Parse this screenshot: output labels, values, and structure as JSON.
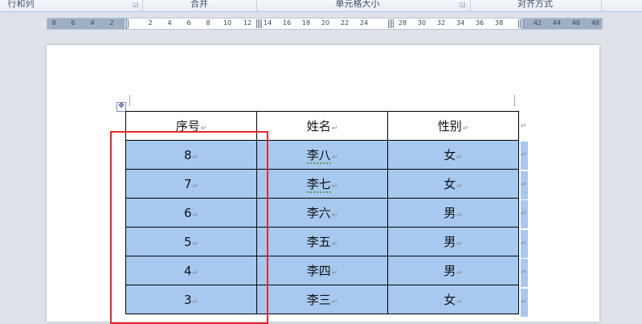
{
  "ribbon": {
    "groups": [
      {
        "label": "行和列"
      },
      {
        "label": "合并"
      },
      {
        "label": "单元格大小"
      },
      {
        "label": "对齐方式"
      }
    ]
  },
  "ruler": {
    "ticks": [
      "8",
      "6",
      "4",
      "2",
      "2",
      "4",
      "6",
      "8",
      "10",
      "12",
      "14",
      "16",
      "18",
      "20",
      "22",
      "24",
      "28",
      "30",
      "32",
      "34",
      "36",
      "38",
      "42",
      "44",
      "46",
      "48"
    ]
  },
  "table": {
    "headers": [
      "序号",
      "姓名",
      "性别"
    ],
    "rows": [
      {
        "num": "8",
        "name": "李八",
        "gender": "女"
      },
      {
        "num": "7",
        "name": "李七",
        "gender": "女"
      },
      {
        "num": "6",
        "name": "李六",
        "gender": "男"
      },
      {
        "num": "5",
        "name": "李五",
        "gender": "男"
      },
      {
        "num": "4",
        "name": "李四",
        "gender": "男"
      },
      {
        "num": "3",
        "name": "李三",
        "gender": "女"
      }
    ],
    "cell_mark": "↵",
    "selection_color": "#a7c8ef"
  },
  "annotation": {
    "color": "#e8262d"
  }
}
